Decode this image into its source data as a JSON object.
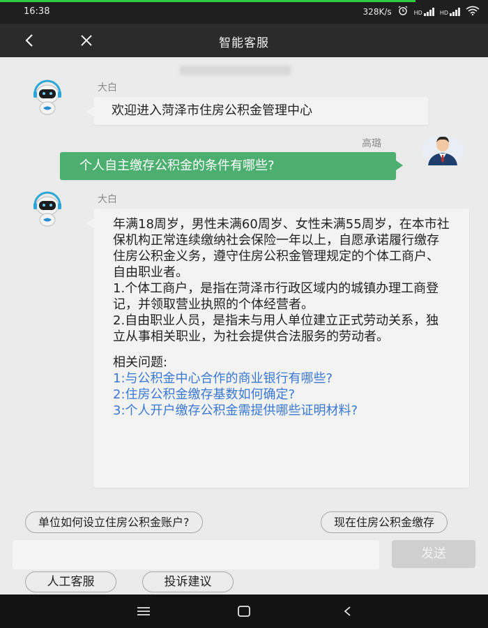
{
  "status_bar": {
    "time": "16:38",
    "speed": "328K/s",
    "alarm_icon": "alarm-icon",
    "hd_label": "HD",
    "wifi_icon": "wifi-icon",
    "accent_color": "#2ecc40"
  },
  "title_bar": {
    "title": "智能客服",
    "back_icon": "back-arrow-icon",
    "close_icon": "close-icon"
  },
  "messages": [
    {
      "sender": "大白",
      "side": "left",
      "text": "欢迎进入菏泽市住房公积金管理中心"
    },
    {
      "sender": "高璐",
      "side": "right",
      "text": "个人自主缴存公积金的条件有哪些?"
    },
    {
      "sender": "大白",
      "side": "left",
      "paragraphs": [
        "年满18周岁，男性未满60周岁、女性未满55周岁，在本市社保机构正常连续缴纳社会保险一年以上，自愿承诺履行缴存住房公积金义务，遵守住房公积金管理规定的个体工商户、自由职业者。",
        "1.个体工商户，是指在菏泽市行政区域内的城镇办理工商登记，并领取营业执照的个体经营者。",
        "2.自由职业人员，是指未与用人单位建立正式劳动关系，独立从事相关职业，为社会提供合法服务的劳动者。"
      ],
      "related_title": "相关问题:",
      "related": [
        "1:与公积金中心合作的商业银行有哪些?",
        "2:住房公积金缴存基数如何确定?",
        "3:个人开户缴存公积金需提供哪些证明材料?"
      ]
    }
  ],
  "quick_questions": [
    "单位如何设立住房公积金账户?",
    "现在住房公积金缴存"
  ],
  "input": {
    "placeholder": "",
    "value": ""
  },
  "send_label": "发送",
  "bottom_buttons": [
    "人工客服",
    "投诉建议"
  ],
  "colors": {
    "user_bubble": "#4caf70",
    "bot_bubble": "#f3f3f3",
    "link": "#3a77d3",
    "background": "#ebebeb"
  }
}
